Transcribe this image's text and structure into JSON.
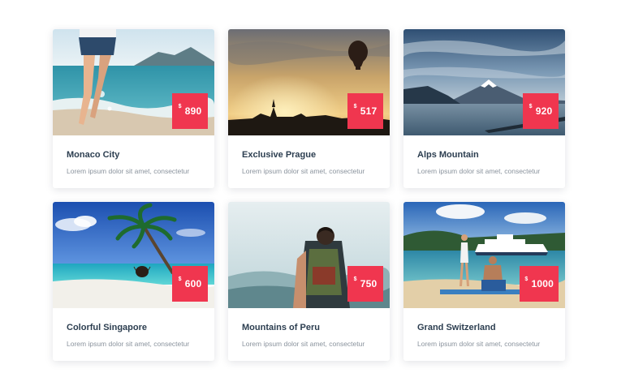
{
  "cards": [
    {
      "title": "Monaco City",
      "description": "Lorem ipsum dolor sit amet, consectetur",
      "currency": "$",
      "price": "890",
      "image": "beach-legs-splash-photo"
    },
    {
      "title": "Exclusive Prague",
      "description": "Lorem ipsum dolor sit amet, consectetur",
      "currency": "$",
      "price": "517",
      "image": "sunset-hot-air-balloon-photo"
    },
    {
      "title": "Alps Mountain",
      "description": "Lorem ipsum dolor sit amet, consectetur",
      "currency": "$",
      "price": "920",
      "image": "snowy-mountain-lake-photo"
    },
    {
      "title": "Colorful Singapore",
      "description": "Lorem ipsum dolor sit amet, consectetur",
      "currency": "$",
      "price": "600",
      "image": "palm-tree-beach-photo"
    },
    {
      "title": "Mountains of Peru",
      "description": "Lorem ipsum dolor sit amet, consectetur",
      "currency": "$",
      "price": "750",
      "image": "hiker-backpack-mountains-photo"
    },
    {
      "title": "Grand Switzerland",
      "description": "Lorem ipsum dolor sit amet, consectetur",
      "currency": "$",
      "price": "1000",
      "image": "beach-couple-cruise-ship-photo"
    }
  ],
  "colors": {
    "price_badge": "#f0364f",
    "title": "#2c3e50",
    "description": "#8a939d"
  }
}
